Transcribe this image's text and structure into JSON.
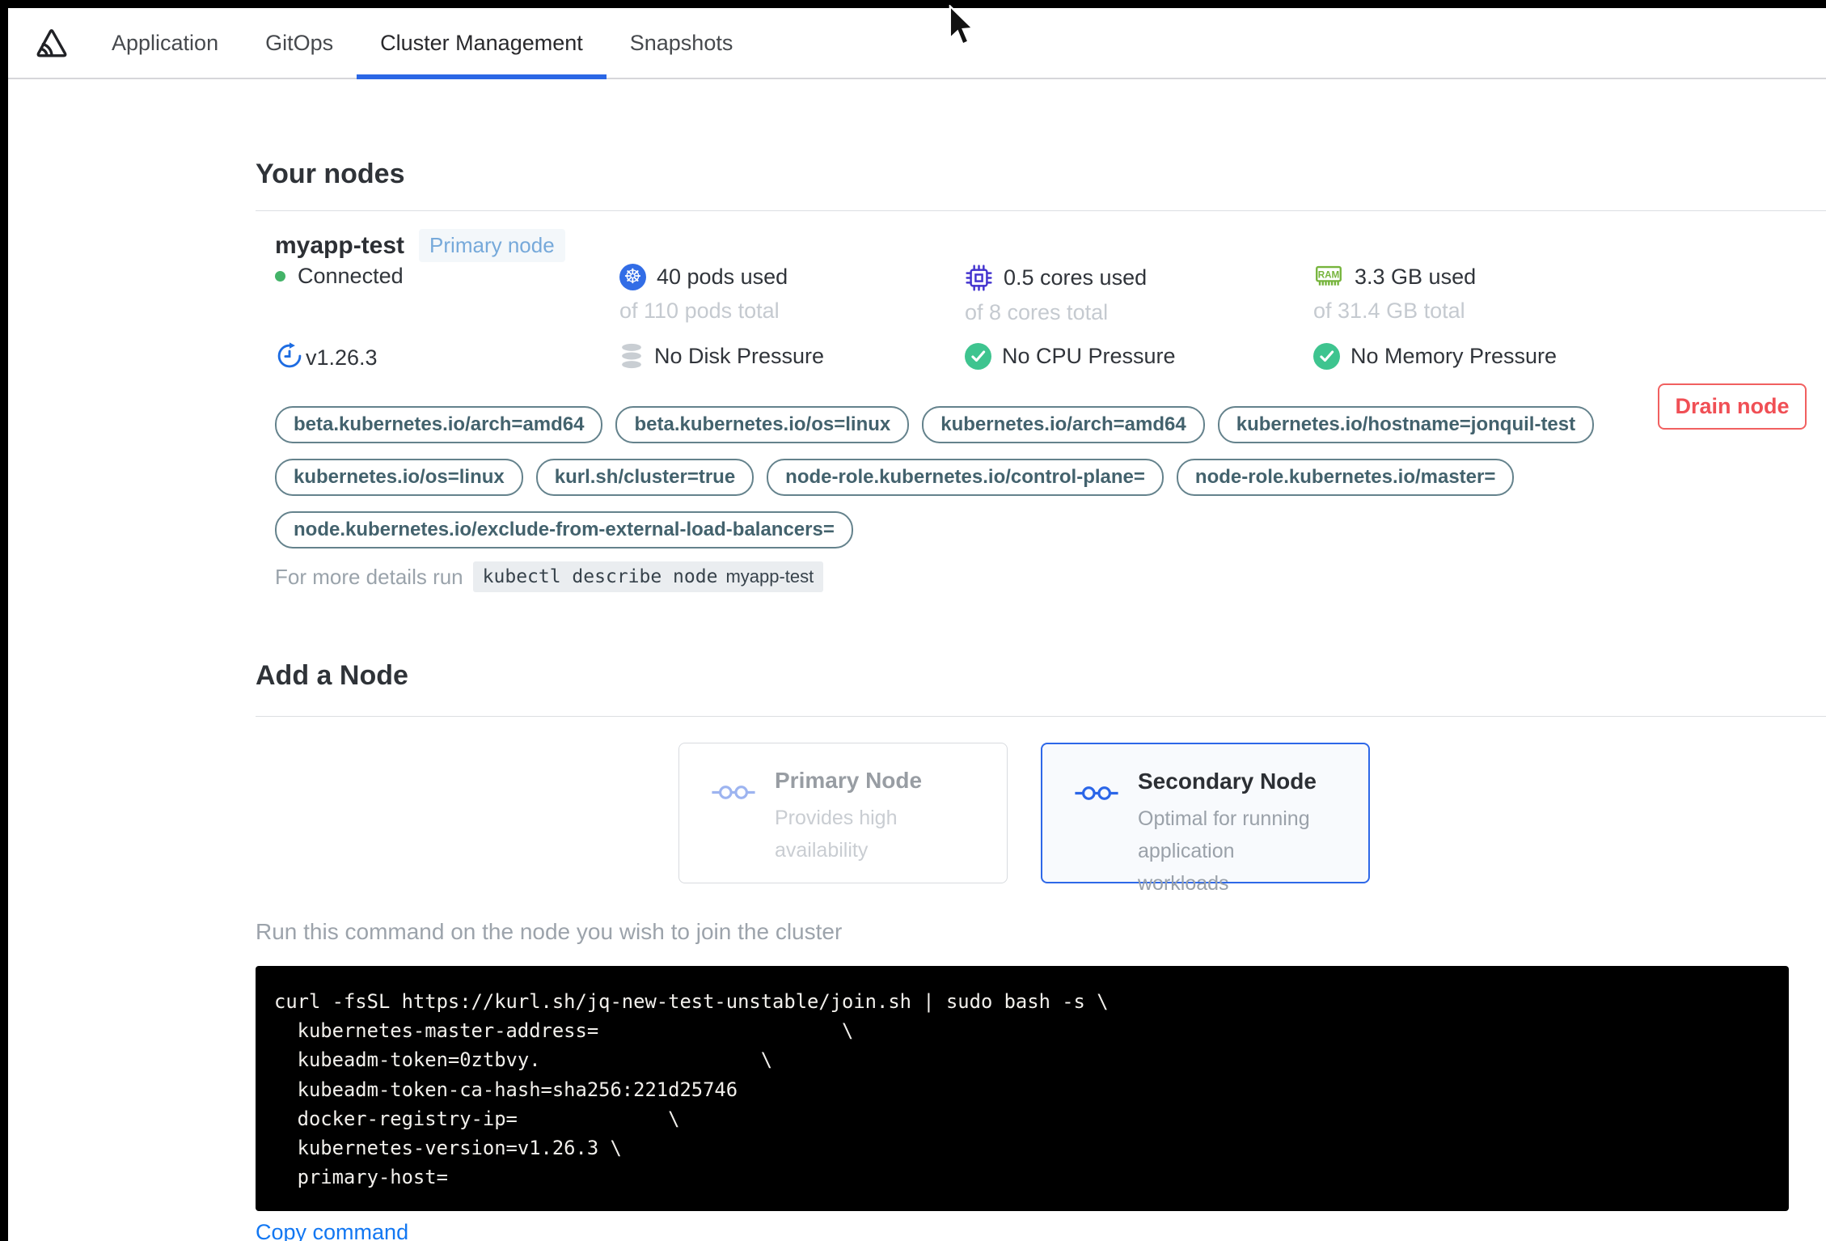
{
  "colors": {
    "accent_blue": "#2b67e5",
    "kubernetes_blue": "#326de6",
    "cpu_indigo": "#4435cf",
    "ram_green": "#76b43c",
    "check_green": "#3ec48f",
    "connected_green": "#43b368",
    "drain_red": "#f04f55",
    "link_blue": "#1277f2",
    "pill_teal": "#43626d",
    "badge_blue": "#76a9da"
  },
  "nav": {
    "logo_icon": "replicated-logo",
    "tabs": [
      {
        "label": "Application",
        "active": false
      },
      {
        "label": "GitOps",
        "active": false
      },
      {
        "label": "Cluster Management",
        "active": true
      },
      {
        "label": "Snapshots",
        "active": false
      }
    ]
  },
  "your_nodes": {
    "title": "Your nodes",
    "node": {
      "name": "myapp-test",
      "badge": "Primary node",
      "status": "Connected",
      "version": "v1.26.3",
      "stats": [
        {
          "icon": "kubernetes-icon",
          "used": "40 pods used",
          "total": "of 110 pods total"
        },
        {
          "icon": "cpu-icon",
          "used": "0.5 cores used",
          "total": "of 8 cores total"
        },
        {
          "icon": "ram-icon",
          "used": "3.3 GB used",
          "total": "of 31.4 GB total"
        }
      ],
      "conditions": [
        {
          "icon": "disk-icon",
          "label": "No Disk Pressure"
        },
        {
          "icon": "check-icon",
          "label": "No CPU Pressure"
        },
        {
          "icon": "check-icon",
          "label": "No Memory Pressure"
        }
      ],
      "labels": [
        "beta.kubernetes.io/arch=amd64",
        "beta.kubernetes.io/os=linux",
        "kubernetes.io/arch=amd64",
        "kubernetes.io/hostname=jonquil-test",
        "kubernetes.io/os=linux",
        "kurl.sh/cluster=true",
        "node-role.kubernetes.io/control-plane=",
        "node-role.kubernetes.io/master=",
        "node.kubernetes.io/exclude-from-external-load-balancers="
      ],
      "details_prefix": "For more details run",
      "details_command": "kubectl describe node",
      "details_node": "myapp-test",
      "drain_label": "Drain node"
    }
  },
  "add_node": {
    "title": "Add a Node",
    "options": [
      {
        "icon": "node-link-icon",
        "title": "Primary Node",
        "subtitle": "Provides high availability",
        "selected": false
      },
      {
        "icon": "node-link-icon",
        "title": "Secondary Node",
        "subtitle": "Optimal for running application workloads",
        "selected": true
      }
    ],
    "instruction": "Run this command on the node you wish to join the cluster",
    "command_lines": [
      "curl -fsSL https://kurl.sh/jq-new-test-unstable/join.sh | sudo bash -s \\",
      "  kubernetes-master-address=                     \\",
      "  kubeadm-token=0ztbvy.                   \\",
      "  kubeadm-token-ca-hash=sha256:221d25746",
      "  docker-registry-ip=             \\",
      "  kubernetes-version=v1.26.3 \\",
      "  primary-host="
    ],
    "copy_label": "Copy command"
  }
}
